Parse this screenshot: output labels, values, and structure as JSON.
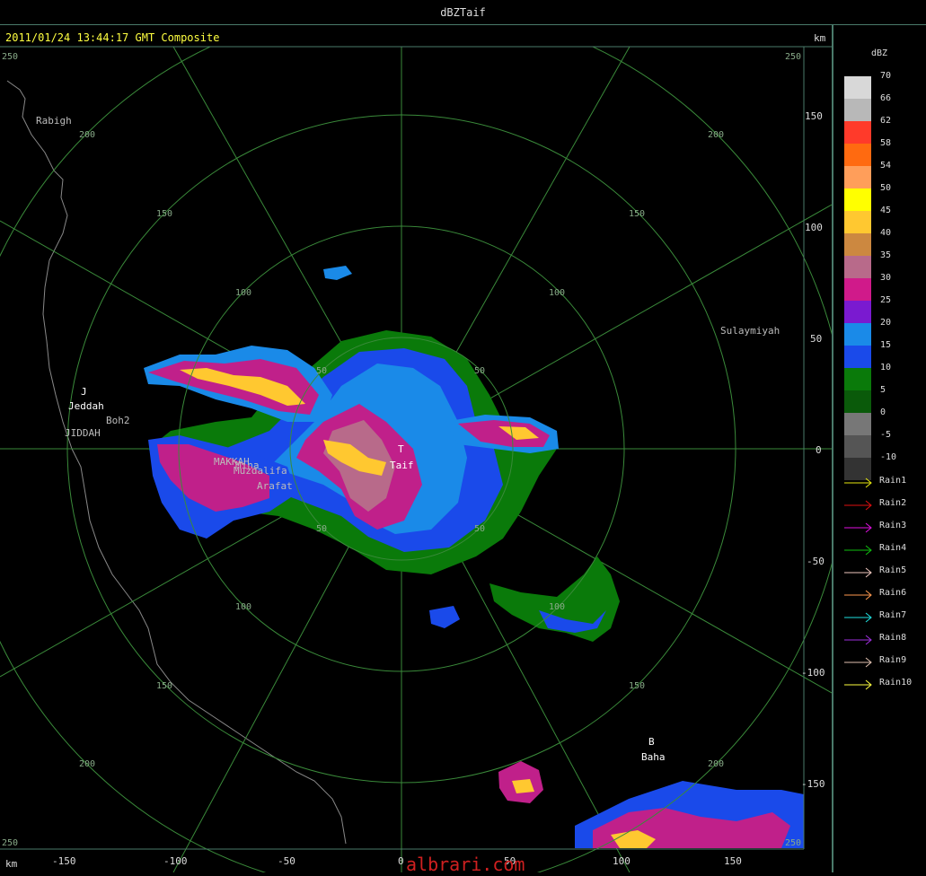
{
  "window": {
    "title": "dBZTaif"
  },
  "header": {
    "timestamp": "2011/01/24 13:44:17 GMT Composite",
    "unit_top": "km"
  },
  "axes": {
    "unit_bottom": "km",
    "x_ticks": [
      "-150",
      "-100",
      "-50",
      "0",
      "50",
      "100",
      "150"
    ],
    "y_ticks": [
      "150",
      "100",
      "50",
      "0",
      "-50",
      "-100",
      "-150"
    ],
    "corner_ticks": [
      "250",
      "250",
      "250",
      "250"
    ]
  },
  "rings": {
    "range_labels_50": [
      "50",
      "50",
      "50",
      "50"
    ],
    "range_labels_100": [
      "100",
      "100",
      "100",
      "100"
    ],
    "range_labels_150": [
      "150",
      "150",
      "150",
      "150"
    ],
    "range_labels_200": [
      "200",
      "200",
      "200",
      "200"
    ]
  },
  "places": {
    "rabigh": "Rabigh",
    "jeddah_letter": "J",
    "jeddah": "Jeddah",
    "boh2": "Boh2",
    "jiddah": "JIDDAH",
    "makkah": "MAKKAH",
    "mina": "Mina",
    "muzdalifa": "Muzdalifa",
    "arafat": "Arafat",
    "taif_letter": "T",
    "taif": "Taif",
    "sulaymiyah": "Sulaymiyah",
    "baha_letter": "B",
    "baha": "Baha"
  },
  "watermark": "albrari.com",
  "legend": {
    "unit": "dBZ",
    "levels": [
      "70",
      "66",
      "62",
      "58",
      "54",
      "50",
      "45",
      "40",
      "35",
      "30",
      "25",
      "20",
      "15",
      "10",
      "5",
      "0",
      "-5",
      "-10"
    ],
    "colors": [
      "#d8d8d8",
      "#b8b8b8",
      "#ff3a2a",
      "#ff6a10",
      "#ff9e5a",
      "#ffff00",
      "#ffc830",
      "#cc8840",
      "#b86a8a",
      "#d01a8a",
      "#7a1ad0",
      "#1a8ae8",
      "#1a4aea",
      "#0a7a0a",
      "#0a5a0a",
      "#777777",
      "#555555",
      "#333333"
    ],
    "rains": [
      {
        "label": "Rain1",
        "color": "#e8e810"
      },
      {
        "label": "Rain2",
        "color": "#e01010"
      },
      {
        "label": "Rain3",
        "color": "#e010e0"
      },
      {
        "label": "Rain4",
        "color": "#10c010"
      },
      {
        "label": "Rain5",
        "color": "#f0c8c0"
      },
      {
        "label": "Rain6",
        "color": "#ff9a50"
      },
      {
        "label": "Rain7",
        "color": "#20e0e0"
      },
      {
        "label": "Rain8",
        "color": "#a030e0"
      },
      {
        "label": "Rain9",
        "color": "#e0c0b0"
      },
      {
        "label": "Rain10",
        "color": "#ffff40"
      }
    ]
  }
}
